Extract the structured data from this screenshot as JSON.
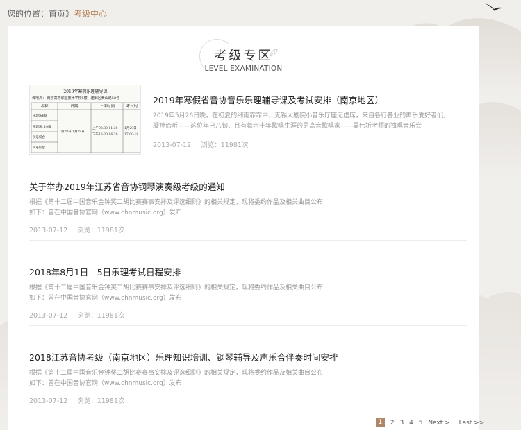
{
  "breadcrumb": {
    "prefix": "您的位置：",
    "home": "首页",
    "separator": "》",
    "current": "考级中心"
  },
  "section": {
    "title_zh": "考级专区",
    "title_en": "LEVEL EXAMINATION"
  },
  "articles": [
    {
      "title": "2019年寒假省音协音乐乐理辅导课及考试安排（南京地区）",
      "summary_line1": "2019年5月26日晚，在初夏的细雨霏霏中，无锡大剧院小音乐厅座无虚席，来自各行各业的声乐爱好者们,",
      "summary_line2": "凝神谛听——这位年已八旬、且有着六十年歌唱生涯的男高音歌唱家——吴伟圻老师的独唱音乐会",
      "date": "2013-07-12",
      "views": "浏览：11981次",
      "thumb": {
        "caption": "2019年寒假乐理辅导课",
        "venue": "课地点：  南京高等职业技术学校5楼（建邺区黄山路58号",
        "headers": [
          "名称",
          "日期",
          "上课时间",
          "考试时"
        ],
        "rows": [
          "乐理乐B级",
          "乐理乐, 10级",
          "民乐综合",
          "声乐综合"
        ],
        "date_range": "1月28日-1月29日",
        "time1": "上午08:30-11:30",
        "time2": "下午13:30-16:30",
        "exam_date": "1月29日",
        "exam_time": "17:00-18"
      }
    },
    {
      "title": "关于举办2019年江苏省音协钢琴演奏级考级的通知",
      "summary_line1": "根据《第十二届中国音乐金钟奖二胡比赛赛事安排及评选细则》的相关规定，现将委约作品及相关曲目公布",
      "summary_line2": "如下：曾在中国音协官网（www.chnmusic.org）发布",
      "date": "2013-07-12",
      "views": "浏览：11981次"
    },
    {
      "title": "2018年8月1日—5日乐理考试日程安排",
      "summary_line1": "根据《第十二届中国音乐金钟奖二胡比赛赛事安排及评选细则》的相关规定，现将委约作品及相关曲目公布",
      "summary_line2": "如下：曾在中国音协官网（www.chnmusic.org）发布",
      "date": "2013-07-12",
      "views": "浏览：11981次"
    },
    {
      "title": "2018江苏音协考级（南京地区）乐理知识培训、钢琴辅导及声乐合伴奏时间安排",
      "summary_line1": "根据《第十二届中国音乐金钟奖二胡比赛赛事安排及评选细则》的相关规定，现将委约作品及相关曲目公布",
      "summary_line2": "如下：曾在中国音协官网（www.chnmusic.org）发布",
      "date": "2013-07-12",
      "views": "浏览：11981次"
    }
  ],
  "pagination": {
    "pages": [
      "1",
      "2",
      "3",
      "4",
      "5"
    ],
    "current_page": "1",
    "next": "Next >",
    "last": "Last >>"
  },
  "colors": {
    "accent": "#b08668",
    "breadcrumb_current": "#b8865c",
    "page_bg": "#f1efec"
  }
}
